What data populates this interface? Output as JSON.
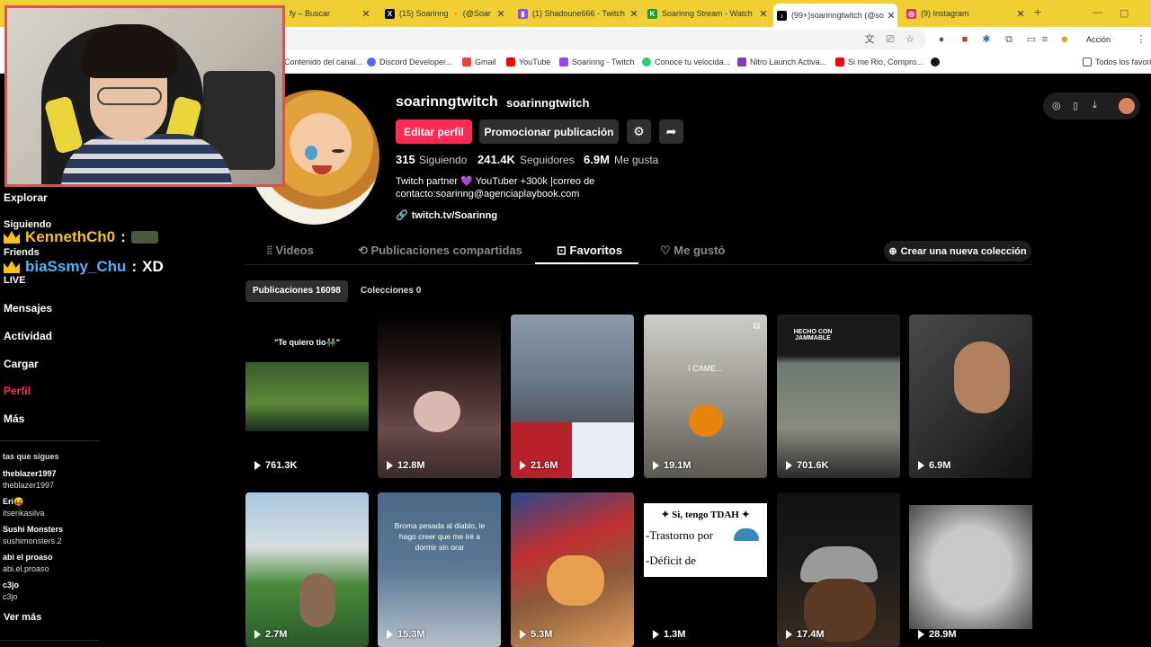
{
  "browser": {
    "tabs": [
      {
        "title": "fy – Buscar",
        "favicon": "search-icon",
        "color": "#4285f4"
      },
      {
        "title": "(15) Soarinng 🔸 (@Soar",
        "favicon": "x-logo-icon",
        "color": "#000000"
      },
      {
        "title": "(1) Shadoune666 - Twitch",
        "favicon": "twitch-icon",
        "color": "#9146ff"
      },
      {
        "title": "Soarinng Stream - Watch",
        "favicon": "kick-icon",
        "color": "#53fc18"
      },
      {
        "title": "(99+)soarinngtwitch (@so",
        "favicon": "tiktok-icon",
        "color": "#000000"
      },
      {
        "title": "(9) Instagram",
        "favicon": "instagram-icon",
        "color": "#e1306c"
      }
    ],
    "accion_button": "Acción obligatoria",
    "bookmarks": [
      "Contenido del canal...",
      "Discord Developer...",
      "Gmail",
      "YouTube",
      "Soarinng - Twitch",
      "Conoce tu velocida...",
      "Nitro Launch Activa...",
      "Si me Rio, Compro...",
      ""
    ],
    "all_bookmarks": "Todos los favorit"
  },
  "sidebar": {
    "explore": "Explorar",
    "following": "Siguiendo",
    "friends": "Friends",
    "live": "LIVE",
    "messages": "Mensajes",
    "activity": "Actividad",
    "upload": "Cargar",
    "profile": "Perfil",
    "more": "Más",
    "following_header": "tas que sigues",
    "accounts": [
      {
        "name": "theblazer1997",
        "handle": "theblazer1997"
      },
      {
        "name": "Eri😝",
        "handle": "itserikasilva"
      },
      {
        "name": "Sushi Monsters",
        "handle": "sushimonsters.2"
      },
      {
        "name": "abi el proaso",
        "handle": "abi.el.proaso"
      },
      {
        "name": "c3jo",
        "handle": "c3jo"
      }
    ],
    "see_more": "Ver más"
  },
  "chat_overlay": [
    {
      "user": "KennethCh0",
      "sep": ":",
      "msg": "",
      "color": "#f5c518"
    },
    {
      "user": "biaSsmy_Chu",
      "sep": ":",
      "msg": "XD",
      "color": "#4fb3ff"
    }
  ],
  "profile": {
    "username": "soarinngtwitch",
    "nickname": "soarinngtwitch",
    "edit_button": "Editar perfil",
    "promote_button": "Promocionar publicación",
    "following_count": "315",
    "following_label": "Siguiendo",
    "followers_count": "241.4K",
    "followers_label": "Seguidores",
    "likes_count": "6.9M",
    "likes_label": "Me gusta",
    "bio_line1": "Twitch partner 💜 YouTuber +300k |correo de",
    "bio_line2": "contacto:soarinng@agenciaplaybook.com",
    "link": "twitch.tv/Soarinng"
  },
  "tabs": {
    "videos": "Videos",
    "reposts": "Publicaciones compartidas",
    "favorites": "Favoritos",
    "liked": "Me gustó",
    "new_collection": "Crear una nueva colección",
    "publications": "Publicaciones 16098",
    "collections": "Colecciones 0"
  },
  "videos": [
    {
      "views": "761.3K",
      "caption": "\"Te quiero tio👬\"",
      "bg": "#111111"
    },
    {
      "views": "12.8M",
      "caption": "",
      "bg": "#3a2a2a"
    },
    {
      "views": "21.6M",
      "caption": "",
      "bg": "#6b7a88"
    },
    {
      "views": "19.1M",
      "caption": "I CAME...",
      "bg": "#9a9890"
    },
    {
      "views": "701.6K",
      "caption": "HECHO CON JAMMABLE",
      "bg": "#6d7a70"
    },
    {
      "views": "6.9M",
      "caption": "",
      "bg": "#2a2a2a"
    },
    {
      "views": "2.7M",
      "caption": "",
      "bg": "#7aa0b8"
    },
    {
      "views": "15.3M",
      "caption": "Broma pesada al diablo, le hago creer que me iré a dormir sin orar",
      "bg": "#5a7a98"
    },
    {
      "views": "5.3M",
      "caption": "",
      "bg": "#8a5a3a"
    },
    {
      "views": "1.3M",
      "caption": "✦ Si, tengo TDAH ✦",
      "bg": "#ffffff"
    },
    {
      "views": "17.4M",
      "caption": "",
      "bg": "#1a1a1a"
    },
    {
      "views": "28.9M",
      "caption": "",
      "bg": "#c8c8c8"
    }
  ],
  "video_text": {
    "tdah_line2": "-Trastorno por",
    "tdah_line3": "-Déficit de"
  },
  "colors": {
    "accent": "#fe2c55",
    "tab_bar": "#f0cf33",
    "webcam_border": "#d9534f"
  }
}
